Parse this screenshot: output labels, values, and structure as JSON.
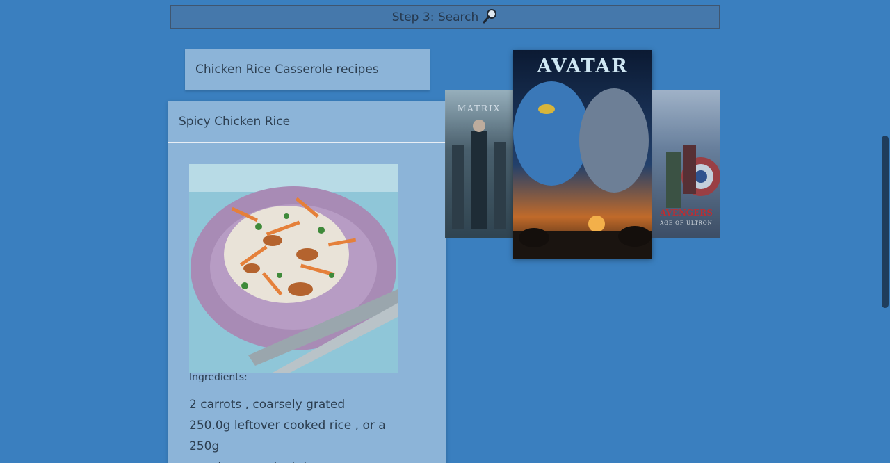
{
  "search": {
    "label": "Step 3: Search",
    "icon": "magnifier-icon"
  },
  "recipes": {
    "title": "Chicken Rice Casserole recipes",
    "card": {
      "name": "Spicy Chicken Rice",
      "image_alt": "Spicy chicken rice salad on a purple plate",
      "ingredients_label": "Ingredients:",
      "ingredients": [
        "2 carrots , coarsely grated",
        "250.0g leftover cooked rice , or a 250g",
        "pouch pre-cooked rice"
      ]
    }
  },
  "movies": {
    "left": {
      "title": "MATRIX"
    },
    "center": {
      "title": "AVATAR"
    },
    "right": {
      "title": "AVENGERS",
      "subtitle": "AGE OF ULTRON"
    }
  },
  "colors": {
    "background": "#3a7fbf",
    "card": "#8cb4d8",
    "search_border": "#3f5670"
  }
}
